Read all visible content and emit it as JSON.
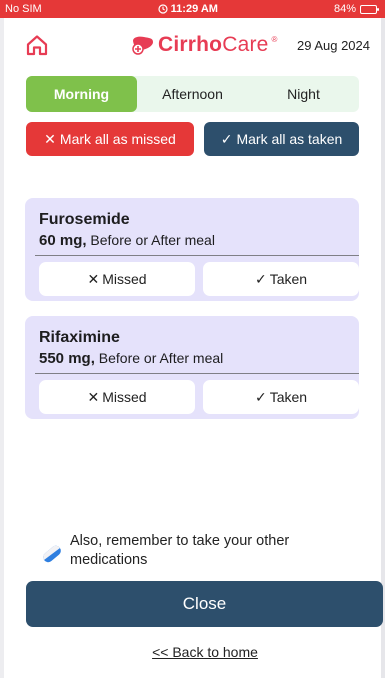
{
  "status_bar": {
    "carrier": "No SIM",
    "time": "11:29 AM",
    "battery": "84%",
    "battery_level": 0.84,
    "color": "#e53838"
  },
  "header": {
    "brand_part1": "Cirrho",
    "brand_part2": "Care",
    "brand_reg": "®",
    "date": "29 Aug 2024",
    "home_icon": "home-icon",
    "brand_color": "#e73c54"
  },
  "tabs": [
    {
      "label": "Morning",
      "active": true
    },
    {
      "label": "Afternoon",
      "active": false
    },
    {
      "label": "Night",
      "active": false
    }
  ],
  "mark_all": {
    "missed_label": "Mark all as missed",
    "taken_label": "Mark all as taken"
  },
  "medications": [
    {
      "name": "Furosemide",
      "dose": "60 mg,",
      "timing": "Before or After meal",
      "missed_label": "Missed",
      "taken_label": "Taken"
    },
    {
      "name": "Rifaximine",
      "dose": "550 mg,",
      "timing": "Before or After meal",
      "missed_label": "Missed",
      "taken_label": "Taken"
    }
  ],
  "reminder": {
    "text": "Also, remember to take your other medications",
    "icon": "pill-icon"
  },
  "close_label": "Close",
  "back_link": "<< Back to home",
  "colors": {
    "accent_green": "#7fc14b",
    "danger": "#e53838",
    "primary": "#2d4f6c",
    "card_bg": "#e5e2fb",
    "tab_bg": "#eaf7ec"
  }
}
